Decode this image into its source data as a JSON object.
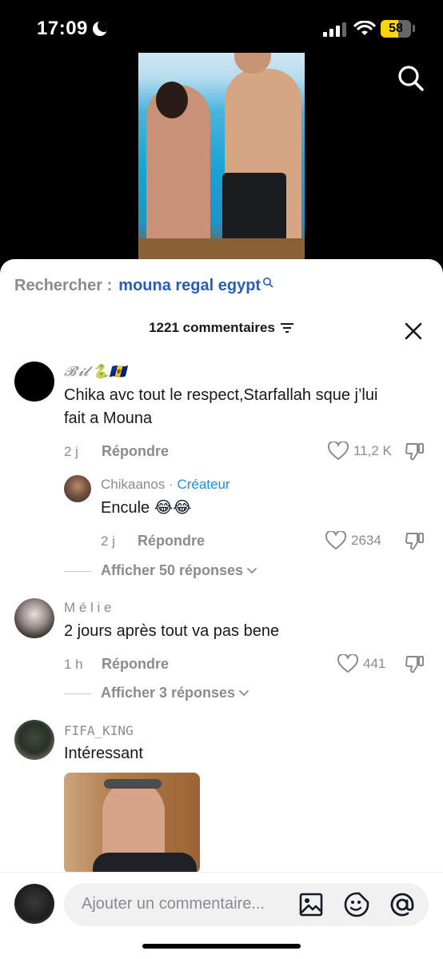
{
  "status_bar": {
    "time": "17:09",
    "battery": "58",
    "battery_level": 0.58
  },
  "search_hint": {
    "label": "Rechercher :",
    "term": "mouna regal egypt"
  },
  "comments_header": {
    "count_label": "1221 commentaires"
  },
  "comments": [
    {
      "username": "𝓑'𝓲𝓵 🐍🇧🇧",
      "text_line1": "Chika avc tout le respect,Starfallah sque j’lui",
      "text_line2": "fait a Mouna",
      "time": "2 j",
      "reply_label": "Répondre",
      "likes": "11,2 K",
      "replies": [
        {
          "username": "Chikaanos",
          "separator": " · ",
          "badge": "Créateur",
          "text": "Encule 😂😂",
          "time": "2 j",
          "reply_label": "Répondre",
          "likes": "2634"
        }
      ],
      "view_replies": "Afficher 50 réponses"
    },
    {
      "username": "M é l i e",
      "text": "2 jours après tout va pas bene",
      "time": "1 h",
      "reply_label": "Répondre",
      "likes": "441",
      "view_replies": "Afficher 3 réponses"
    },
    {
      "username": "FIFA_KING",
      "text": "Intéressant"
    }
  ],
  "composer": {
    "placeholder": "Ajouter un commentaire..."
  },
  "icons": {
    "search_top": "search-icon",
    "close": "close-icon",
    "filter": "filter-icon",
    "like": "heart-icon",
    "dislike": "dislike-icon",
    "image": "image-icon",
    "emoji": "emoji-icon",
    "mention": "at-icon"
  }
}
